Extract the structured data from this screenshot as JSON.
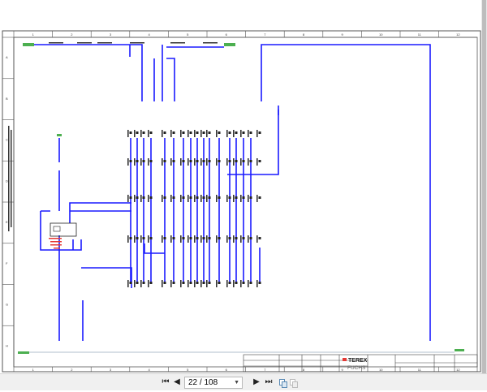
{
  "document": {
    "columns": [
      "1",
      "2",
      "3",
      "4",
      "5",
      "6",
      "7",
      "8",
      "9",
      "10",
      "11",
      "12"
    ],
    "rows": [
      "A",
      "B",
      "C",
      "D",
      "E",
      "F",
      "G",
      "H"
    ],
    "title_block": {
      "brand": "TEREX",
      "sub_brand": "FUCHS"
    },
    "relay_note_color": "#e53935",
    "wire_color": "#1a1aff"
  },
  "toolbar": {
    "first_page": "⏮",
    "prev_page": "◀",
    "current_page": "22",
    "total_pages": "108",
    "page_display": "22 / 108",
    "next_page": "▶",
    "last_page": "⏭"
  }
}
